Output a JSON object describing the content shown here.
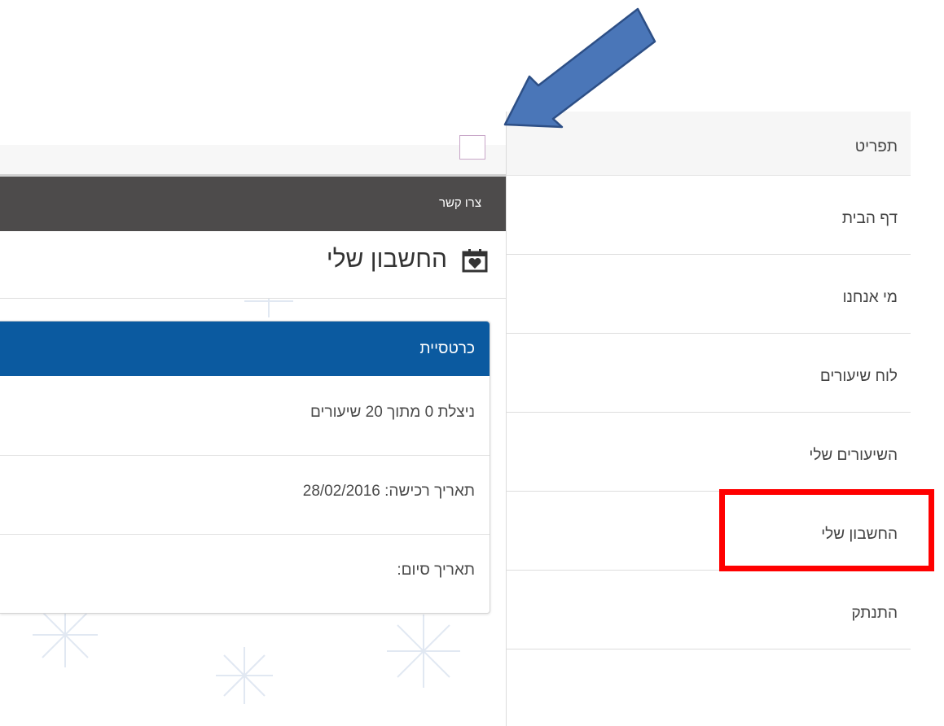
{
  "menu": {
    "title": "תפריט",
    "items": [
      {
        "label": "דף הבית"
      },
      {
        "label": "מי אנחנו"
      },
      {
        "label": "לוח שיעורים"
      },
      {
        "label": "השיעורים שלי"
      },
      {
        "label": "החשבון שלי"
      },
      {
        "label": "התנתק"
      }
    ]
  },
  "contact_bar": {
    "label": "צרו קשר"
  },
  "page_heading": {
    "title": "החשבון שלי",
    "icon": "calendar-heart-icon"
  },
  "card": {
    "header": "כרטסיית",
    "rows": [
      {
        "text": "ניצלת 0 מתוך 20 שיעורים"
      },
      {
        "text": "תאריך רכישה: 28/02/2016"
      },
      {
        "text": "תאריך סיום:"
      }
    ]
  },
  "colors": {
    "accent_blue": "#0b5aa0",
    "contact_bar": "#4d4b4b",
    "annotation_arrow": "#4a76b8",
    "annotation_highlight": "#ff0000"
  }
}
